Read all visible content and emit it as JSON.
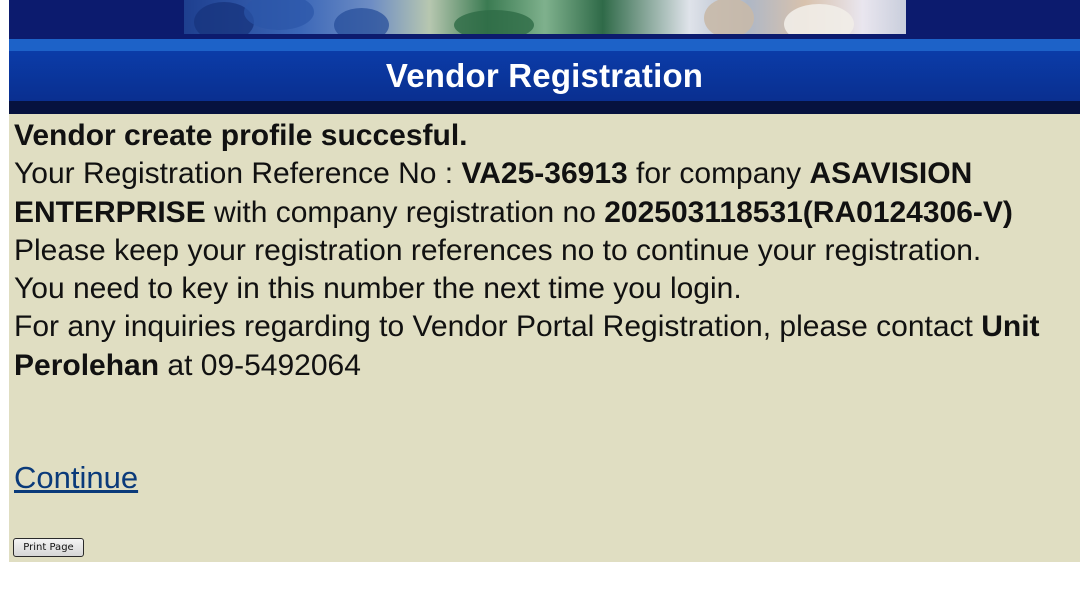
{
  "header": {
    "title": "Vendor Registration"
  },
  "message": {
    "heading": "Vendor create profile succesful.",
    "ref_prefix": "Your Registration Reference No : ",
    "ref_no": "VA25-36913",
    "for_company_text": " for company ",
    "company_name": "ASAVISION ENTERPRISE",
    "reg_no_text": " with company registration no ",
    "company_reg_no": "202503118531(RA0124306-V)",
    "keep_ref_line": "Please keep your registration references no to continue your registration.",
    "key_in_line": "You need to key in this number the next time you login.",
    "inquiry_line": "For any inquiries regarding to Vendor Portal Registration, please contact ",
    "contact_unit": "Unit Perolehan",
    "at_text": " at ",
    "contact_phone": "09-5492064"
  },
  "actions": {
    "continue_label": "Continue",
    "print_label": "Print Page"
  }
}
